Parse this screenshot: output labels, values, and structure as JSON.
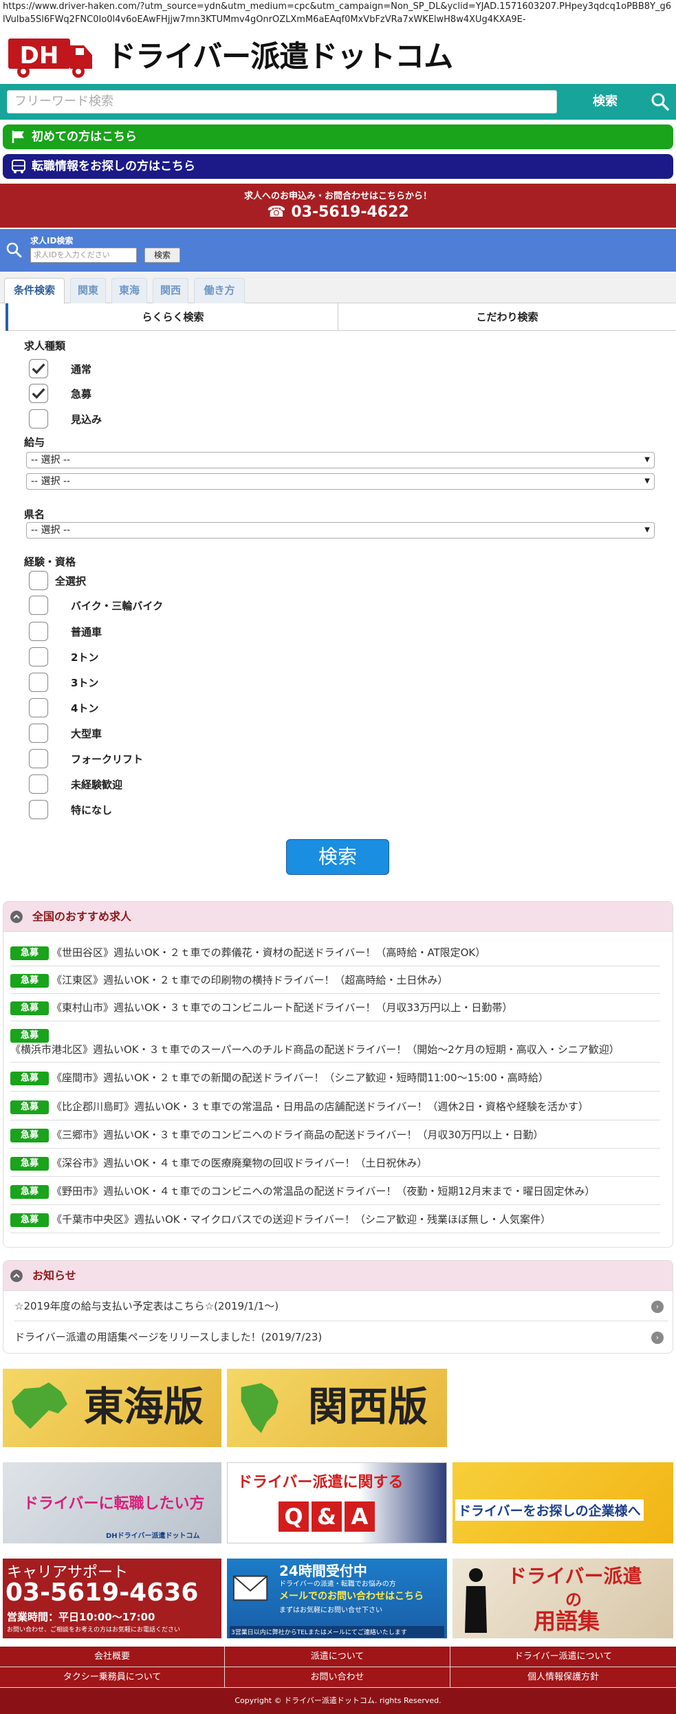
{
  "browser": {
    "url": "https://www.driver-haken.com/?utm_source=ydn&utm_medium=cpc&utm_campaign=Non_SP_DL&yclid=YJAD.1571603207.PHpey3qdcq1oPBB8Y_g6lVulba5Sl6FWq2FNC0Io0l4v6oEAwFHjjw7mn3KTUMmv4gOnrOZLXmM6aEAqf0MxVbFzVRa7xWKElwH8w4XUg4KXA9E-"
  },
  "header": {
    "logo_mark": "DH",
    "site_title": "ドライバー派遣ドットコム"
  },
  "search": {
    "placeholder": "フリーワード検索",
    "button_label": "検索"
  },
  "links": {
    "first_time": "初めての方はこちら",
    "job_change": "転職情報をお探しの方はこちら"
  },
  "contact": {
    "subtitle": "求人へのお申込み・お問合わせはこちらから！",
    "phone": "☎ 03-5619-4622"
  },
  "id_search": {
    "label": "求人ID検索",
    "placeholder": "求人IDを入力ください",
    "button_label": "検索"
  },
  "tabs": [
    "条件検索",
    "関東",
    "東海",
    "関西",
    "働き方"
  ],
  "subtabs": {
    "easy": "らくらく検索",
    "detail": "こだわり検索"
  },
  "form": {
    "job_type_label": "求人種類",
    "job_types": [
      {
        "label": "通常",
        "checked": true
      },
      {
        "label": "急募",
        "checked": true
      },
      {
        "label": "見込み",
        "checked": false
      }
    ],
    "salary_label": "給与",
    "salary_select_1": "-- 選択 --",
    "salary_select_2": "-- 選択 --",
    "prefecture_label": "県名",
    "prefecture_select": "-- 選択 --",
    "experience_label": "経験・資格",
    "experiences": [
      "全選択",
      "バイク・三輪バイク",
      "普通車",
      "2トン",
      "3トン",
      "4トン",
      "大型車",
      "フォークリフト",
      "未経験歓迎",
      "特になし"
    ],
    "submit_label": "検索"
  },
  "recommended": {
    "title": "全国のおすすめ求人",
    "badge_label": "急募",
    "jobs": [
      "《世田谷区》週払いOK・２ｔ車での葬儀花・資材の配送ドライバー！（高時給・AT限定OK）",
      "《江東区》週払いOK・２ｔ車での印刷物の横持ドライバー！（超高時給・土日休み）",
      "《東村山市》週払いOK・３ｔ車でのコンビニルート配送ドライバー！（月収33万円以上・日勤帯）",
      "《横浜市港北区》週払いOK・３ｔ車でのスーパーへのチルド商品の配送ドライバー！（開始～2ケ月の短期・高収入・シニア歓迎）",
      "《座間市》週払いOK・２ｔ車での新聞の配送ドライバー！（シニア歓迎・短時間11:00～15:00・高時給）",
      "《比企郡川島町》週払いOK・３ｔ車での常温品・日用品の店舗配送ドライバー！（週休2日・資格や経験を活かす）",
      "《三郷市》週払いOK・３ｔ車でのコンビニへのドライ商品の配送ドライバー！（月収30万円以上・日勤）",
      "《深谷市》週払いOK・４ｔ車での医療廃棄物の回収ドライバー！（土日祝休み）",
      "《野田市》週払いOK・４ｔ車でのコンビニへの常温品の配送ドライバー！（夜勤・短期12月末まで・曜日固定休み）",
      "《千葉市中央区》週払いOK・マイクロバスでの送迎ドライバー！（シニア歓迎・残業ほぼ無し・人気案件）"
    ]
  },
  "notices": {
    "title": "お知らせ",
    "items": [
      "☆2019年度の給与支払い予定表はこちら☆(2019/1/1～)",
      "ドライバー派遣の用語集ページをリリースしました！(2019/7/23)"
    ]
  },
  "banners": {
    "tokai": "東海版",
    "kansai": "関西版",
    "career_change": "ドライバーに転職したい方",
    "career_change_sub": "DHドライバー派遣ドットコム",
    "qa_title": "ドライバー派遣に関する",
    "qa_q": "Q",
    "qa_amp": "&",
    "qa_a": "A",
    "company": "ドライバーをお探しの企業様へ",
    "career_support": "キャリアサポート",
    "career_phone": "03-5619-4636",
    "career_hours": "営業時間：平日10:00～17:00",
    "career_note": "お問い合わせ、ご相談をお考えの方はお気軽にお電話ください",
    "mail_title": "24時間受付中",
    "mail_sub1": "ドライバーの派遣・転職でお悩みの方",
    "mail_sub2": "メールでのお問い合わせはこちら",
    "mail_sub3": "まずはお気軽にお問い合せ下さい",
    "mail_note": "3営業日以内に弊社からTELまたはメールにてご連絡いたします",
    "glossary_1": "ドライバー派遣",
    "glossary_2": "の",
    "glossary_3": "用語集"
  },
  "footer": {
    "links": [
      "会社概要",
      "派遣について",
      "ドライバー派遣について",
      "タクシー乗務員について",
      "お問い合わせ",
      "個人情報保護方針"
    ],
    "copyright": "Copyright © ドライバー派遣ドットコム. rights Reserved."
  },
  "colors": {
    "teal": "#17a49b",
    "green": "#19a41b",
    "navy": "#1b1a88",
    "red": "#a81f23",
    "blue": "#4e7ed6"
  }
}
